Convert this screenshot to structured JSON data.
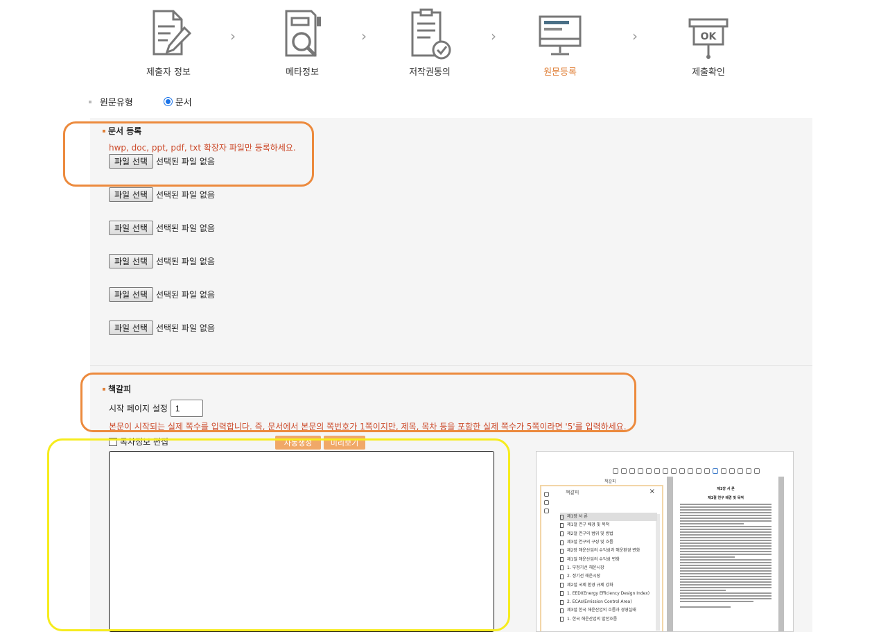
{
  "steps": [
    {
      "label": "제출자 정보",
      "icon": "document-pen-icon",
      "active": false
    },
    {
      "label": "메타정보",
      "icon": "document-search-icon",
      "active": false
    },
    {
      "label": "저작권동의",
      "icon": "document-check-icon",
      "active": false
    },
    {
      "label": "원문등록",
      "icon": "monitor-icon",
      "active": true
    },
    {
      "label": "제출확인",
      "icon": "ok-sign-icon",
      "active": false
    }
  ],
  "step_separator": "›",
  "source_type": {
    "label": "원문유형",
    "option": "문서",
    "selected": true
  },
  "doc_register": {
    "title": "문서 등록",
    "note": "hwp, doc, ppt, pdf, txt 확장자 파일만 등록하세요.",
    "file_button": "파일 선택",
    "no_file": "선택된 파일 없음",
    "file_slots": 6
  },
  "bookmark": {
    "title": "책갈피",
    "start_page_label": "시작 페이지 설정",
    "start_page_value": "1",
    "note": "본문이 시작되는 실제 쪽수를 입력합니다. 즉, 문서에서 본문의 쪽번호가 1쪽이지만, 제목, 목차 등을 포함한 실제 쪽수가 5쪽이라면 '5'를 입력하세요.",
    "checkbox_label": "목차정보 편집",
    "auto_button": "자동생성",
    "preview_button": "미리보기"
  },
  "preview_image": {
    "panel_title": "책갈피",
    "items": [
      "제1장 서 론",
      "제1절 연구 배경 및 목적",
      "제2절 연구의 범위 및 방법",
      "제3절 연구의 구성 및 흐름",
      "제2장 해운산업의 수익성과 해운환경 변화",
      "제1절 해운산업의 수익성 변화",
      "1. 부정기선 해운시장",
      "2. 정기선 해운시장",
      "제2절 국제 환경 규제 강화",
      "1. EEDI(Energy Efficiency Design Index)",
      "2. ECAs(Emission Control Area)",
      "제3절 한국 해운산업의 흐름과 경영실태",
      "1. 한국 해운산업의 발전흐름"
    ],
    "page_heading": "제1장 서 론",
    "page_subheading": "제1절 연구 배경 및 목적"
  },
  "colors": {
    "accent": "#e0813a",
    "note": "#cc4a2a",
    "highlight_orange": "#ec8a3d",
    "highlight_yellow": "#f6ec1e",
    "radio": "#1a73e8"
  }
}
